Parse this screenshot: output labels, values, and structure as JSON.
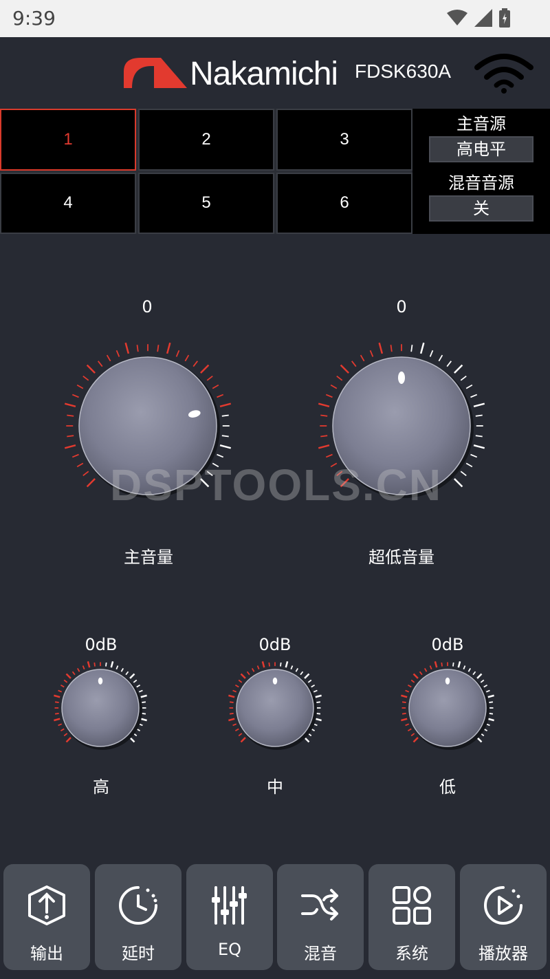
{
  "status": {
    "time": "9:39"
  },
  "header": {
    "brand": "Nakamichi",
    "model": "FDSK630A"
  },
  "presets": [
    "1",
    "2",
    "3",
    "4",
    "5",
    "6"
  ],
  "active_preset": 0,
  "source": {
    "main_title": "主音源",
    "main_value": "高电平",
    "mix_title": "混音音源",
    "mix_value": "关"
  },
  "knobs": {
    "main": {
      "value": "0",
      "label": "主音量",
      "level": 0.78
    },
    "sub": {
      "value": "0",
      "label": "超低音量",
      "level": 0.5
    },
    "high": {
      "value": "0dB",
      "label": "高",
      "level": 0.5
    },
    "mid": {
      "value": "0dB",
      "label": "中",
      "level": 0.5
    },
    "low": {
      "value": "0dB",
      "label": "低",
      "level": 0.5
    }
  },
  "watermark": "DSPTOOLS.CN",
  "nav": [
    {
      "label": "输出",
      "icon": "output-icon"
    },
    {
      "label": "延时",
      "icon": "delay-icon"
    },
    {
      "label": "EQ",
      "icon": "eq-icon"
    },
    {
      "label": "混音",
      "icon": "mix-icon"
    },
    {
      "label": "系统",
      "icon": "system-icon"
    },
    {
      "label": "播放器",
      "icon": "player-icon"
    }
  ],
  "colors": {
    "accent": "#e23a2f",
    "background": "#272a33",
    "nav_button": "#4a4f58"
  }
}
